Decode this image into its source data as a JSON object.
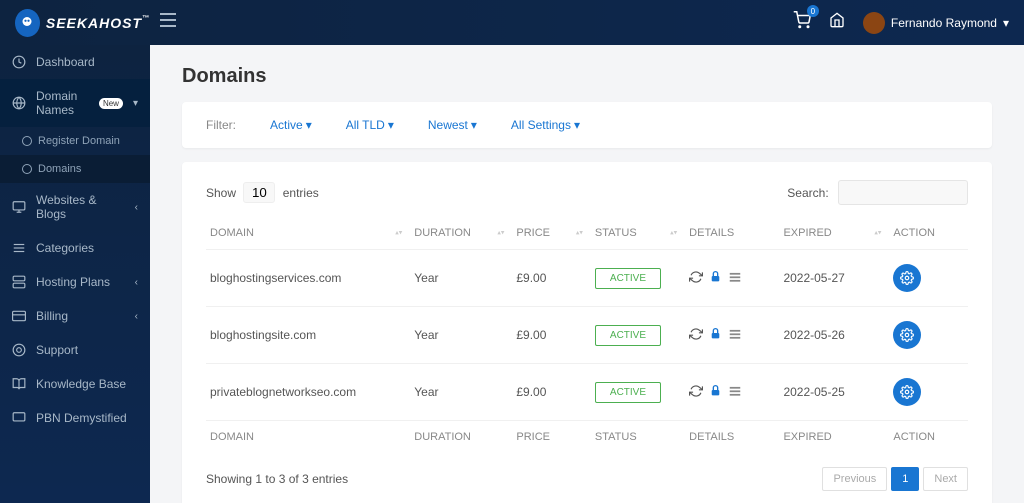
{
  "brand": {
    "name": "SEEKAHOST",
    "tm": "™"
  },
  "header": {
    "cart_count": "0",
    "user_name": "Fernando Raymond"
  },
  "sidebar": {
    "items": [
      {
        "label": "Dashboard",
        "icon": "dashboard"
      },
      {
        "label": "Domain Names",
        "icon": "globe",
        "badge": "New",
        "expanded": true,
        "chevron": "▾"
      },
      {
        "label": "Websites & Blogs",
        "icon": "monitor",
        "chevron": "‹"
      },
      {
        "label": "Categories",
        "icon": "list"
      },
      {
        "label": "Hosting Plans",
        "icon": "server",
        "chevron": "‹"
      },
      {
        "label": "Billing",
        "icon": "card",
        "chevron": "‹"
      },
      {
        "label": "Support",
        "icon": "support"
      },
      {
        "label": "Knowledge Base",
        "icon": "book"
      },
      {
        "label": "PBN Demystified",
        "icon": "desktop"
      }
    ],
    "subitems": [
      {
        "label": "Register Domain"
      },
      {
        "label": "Domains"
      }
    ]
  },
  "page": {
    "title": "Domains"
  },
  "filters": {
    "label": "Filter:",
    "active": "Active",
    "tld": "All TLD",
    "sort": "Newest",
    "settings": "All Settings"
  },
  "table": {
    "show_label_pre": "Show",
    "show_value": "10",
    "show_label_post": "entries",
    "search_label": "Search:",
    "headers": {
      "domain": "DOMAIN",
      "duration": "DURATION",
      "price": "PRICE",
      "status": "STATUS",
      "details": "DETAILS",
      "expired": "EXPIRED",
      "action": "ACTION"
    },
    "rows": [
      {
        "domain": "bloghostingservices.com",
        "duration": "Year",
        "price": "£9.00",
        "status": "ACTIVE",
        "expired": "2022-05-27"
      },
      {
        "domain": "bloghostingsite.com",
        "duration": "Year",
        "price": "£9.00",
        "status": "ACTIVE",
        "expired": "2022-05-26"
      },
      {
        "domain": "privateblognetworkseo.com",
        "duration": "Year",
        "price": "£9.00",
        "status": "ACTIVE",
        "expired": "2022-05-25"
      }
    ],
    "info": "Showing 1 to 3 of 3 entries",
    "pagination": {
      "prev": "Previous",
      "page": "1",
      "next": "Next"
    }
  }
}
